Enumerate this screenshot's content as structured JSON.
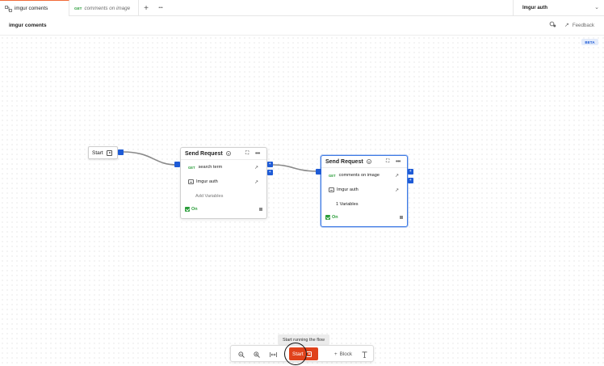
{
  "tabs": [
    {
      "label": "imgur coments",
      "method": "",
      "active": true,
      "icon": "flow-icon"
    },
    {
      "label": "comments on image",
      "method": "GET",
      "active": false
    }
  ],
  "tabbar": {
    "new_tab": "+",
    "more": "•••"
  },
  "environment": {
    "name": "Imgur auth"
  },
  "header": {
    "title": "imgur coments",
    "feedback": "Feedback"
  },
  "canvas": {
    "badge": "BETA"
  },
  "start_block": {
    "label": "Start"
  },
  "blocks": [
    {
      "title": "Send Request",
      "request": {
        "method": "GET",
        "name": "search term"
      },
      "environment": "Imgur auth",
      "variables": "Add Variables",
      "status": "On",
      "selected": false
    },
    {
      "title": "Send Request",
      "request": {
        "method": "GET",
        "name": "comments on image"
      },
      "environment": "Imgur auth",
      "variables": "1 Variables",
      "status": "On",
      "selected": true
    }
  ],
  "tooltip": "Start running the flow",
  "toolbar": {
    "run_label": "Start",
    "add_block_label": "Block"
  },
  "colors": {
    "accent": "#e0421b",
    "port": "#1e5bd6",
    "get": "#2a9d3a",
    "tab_accent": "#f26b3a"
  }
}
